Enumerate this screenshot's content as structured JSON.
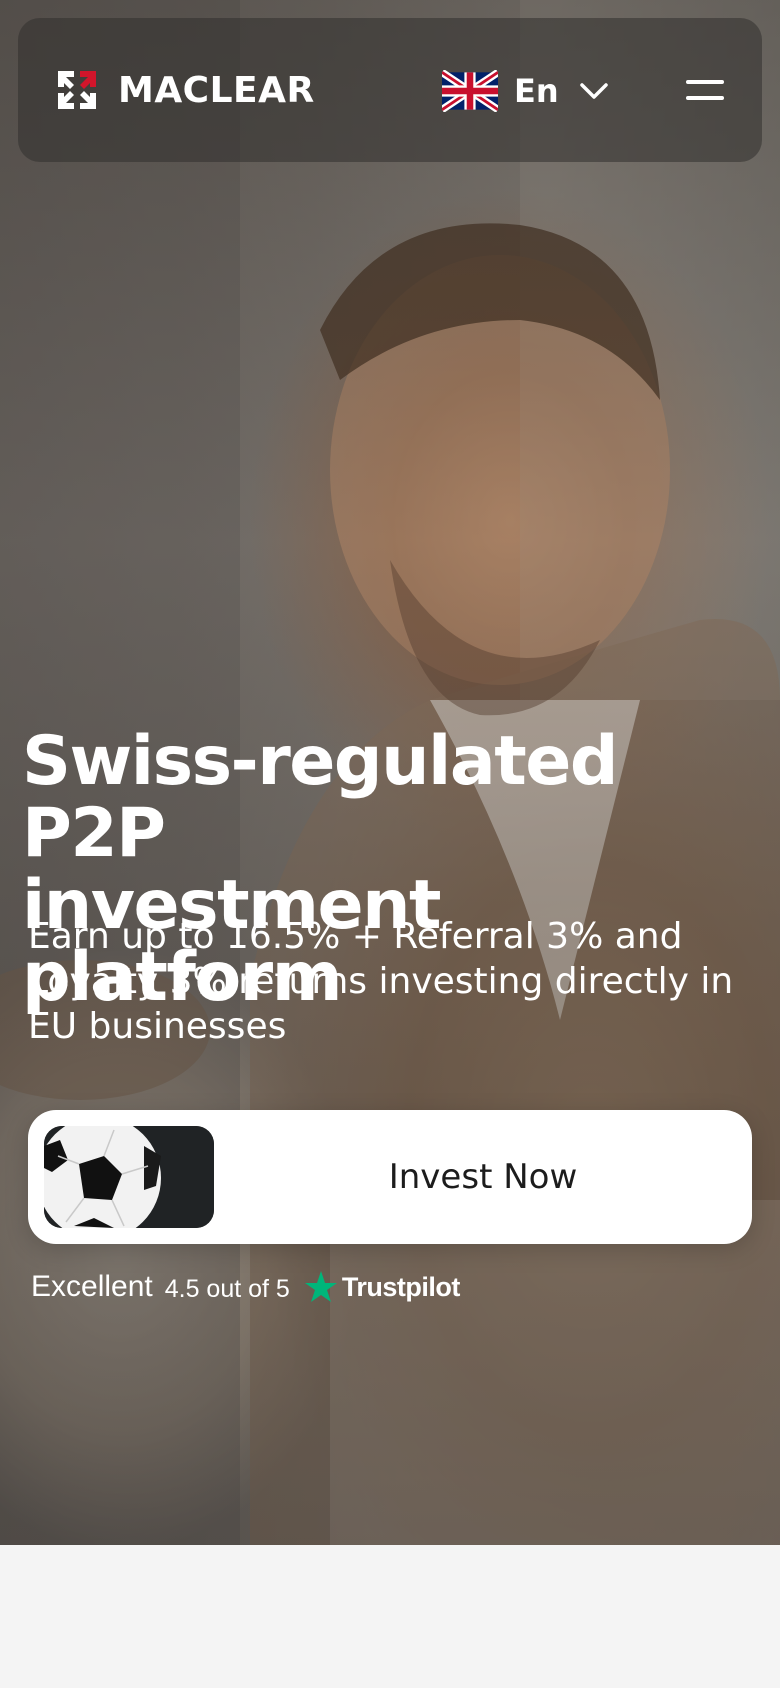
{
  "brand": {
    "name": "MACLEAR",
    "accent_color": "#d2152b"
  },
  "header": {
    "language": {
      "label": "En",
      "flag": "uk-flag-icon",
      "dropdown_icon": "chevron-down-icon"
    },
    "menu_icon": "hamburger-menu-icon"
  },
  "hero": {
    "title_line1": "Swiss-regulated P2P",
    "title_line2": "investment platform",
    "subtitle": "Earn up to 16.5% + Referral 3% and Loyalty 3% returns investing directly in EU businesses",
    "cta": {
      "label": "Invest Now",
      "thumbnail": "soccer-ball-image"
    }
  },
  "rating": {
    "word": "Excellent",
    "score": "4.5 out of 5",
    "provider": "Trustpilot",
    "star_color": "#00b67a"
  }
}
